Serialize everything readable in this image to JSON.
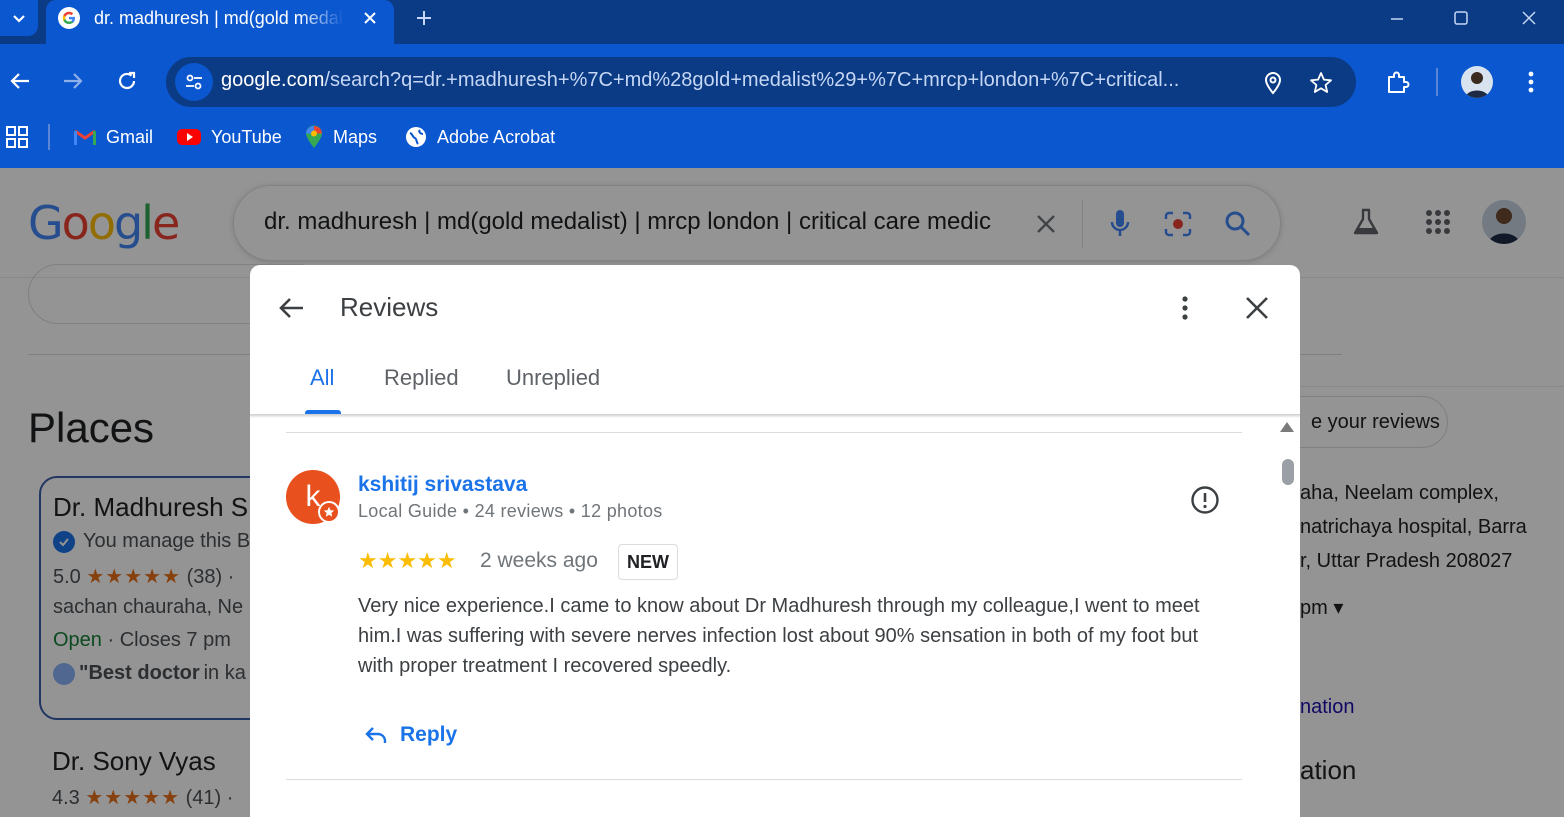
{
  "browser": {
    "tab_title": "dr. madhuresh | md(gold medalist) | mrcp london | critical care medicine",
    "url_host": "google.com",
    "url_path": "/search?q=dr.+madhuresh+%7C+md%28gold+medalist%29+%7C+mrcp+london+%7C+critical...",
    "bookmarks": [
      {
        "label": "Gmail",
        "icon": "gmail-icon"
      },
      {
        "label": "YouTube",
        "icon": "youtube-icon"
      },
      {
        "label": "Maps",
        "icon": "maps-icon"
      },
      {
        "label": "Adobe Acrobat",
        "icon": "globe-icon"
      }
    ]
  },
  "search": {
    "logo": "Google",
    "query": "dr. madhuresh | md(gold medalist) | mrcp london | critical care medic"
  },
  "left": {
    "places_heading": "Places",
    "place1": {
      "name": "Dr. Madhuresh S",
      "manage": "You manage this B",
      "rating_value": "5.0",
      "stars": "★★★★★",
      "rating_count": "(38) ·",
      "address": "sachan chauraha, Ne",
      "open_label": "Open",
      "hours": " · Closes 7 pm",
      "quote_bold": "\"Best doctor",
      "quote_rest": " in ka"
    },
    "place2": {
      "name": "Dr. Sony Vyas",
      "rating_value": "4.3",
      "stars": "★★★★★",
      "rating_count": "(41) ·"
    }
  },
  "right": {
    "your_reviews": "e your reviews",
    "address_lines": [
      "aha, Neelam complex,",
      "natrichaya hospital, Barra",
      "r, Uttar Pradesh 208027"
    ],
    "hours_fragment": "pm ▾",
    "link_fragment": "nation",
    "heading_fragment": "ation"
  },
  "dialog": {
    "title": "Reviews",
    "tabs": [
      {
        "label": "All",
        "active": true
      },
      {
        "label": "Replied",
        "active": false
      },
      {
        "label": "Unreplied",
        "active": false
      }
    ],
    "review": {
      "avatar_letter": "k",
      "name": "kshitij srivastava",
      "meta": "Local Guide • 24 reviews • 12 photos",
      "stars": "★★★★★",
      "rating": 5,
      "time": "2 weeks ago",
      "badge": "NEW",
      "text": "Very nice experience.I came to know about Dr Madhuresh through my colleague,I went to meet him.I was suffering with severe nerves infection lost about 90% sensation in both of my foot but with proper treatment I recovered speedly.",
      "reply_label": "Reply"
    }
  },
  "colors": {
    "chrome_blue": "#0b57d0",
    "tabstrip": "#0a3b84",
    "link_blue": "#1a73e8",
    "star_yellow": "#fbbc04",
    "avatar_orange": "#e8501e"
  }
}
